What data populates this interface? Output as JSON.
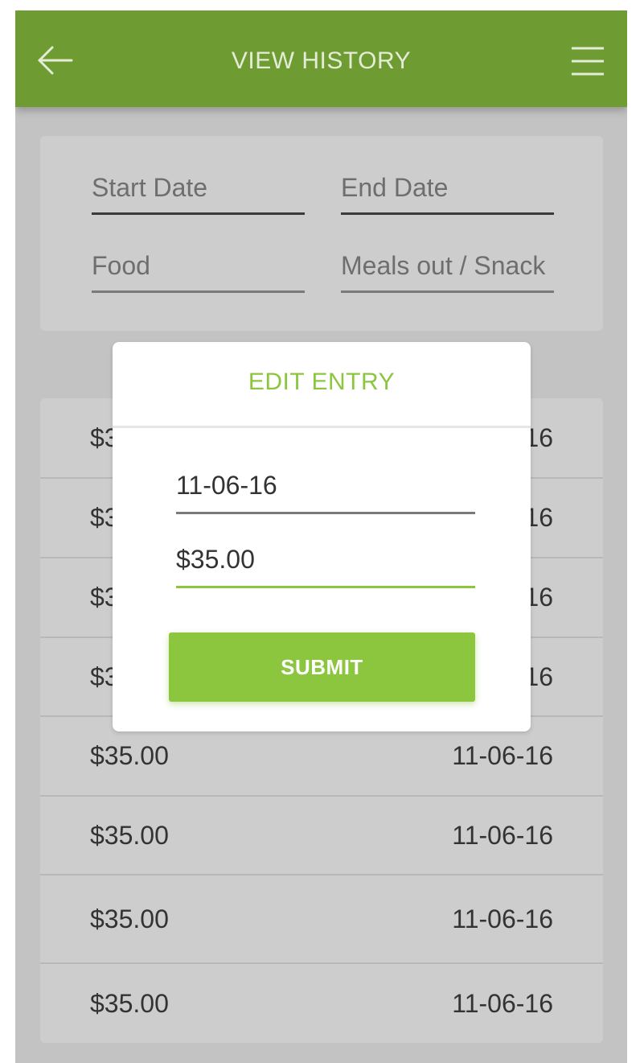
{
  "header": {
    "title": "VIEW HISTORY",
    "back_icon": "arrow-left-icon",
    "menu_icon": "hamburger-menu-icon",
    "background_color": "#6f9c32"
  },
  "filters": {
    "start_date_placeholder": "Start Date",
    "end_date_placeholder": "End Date",
    "food_placeholder": "Food",
    "meals_placeholder": "Meals out / Snack"
  },
  "entries": [
    {
      "amount": "$35.00",
      "date": "11-06-16"
    },
    {
      "amount": "$35.00",
      "date": "11-06-16"
    },
    {
      "amount": "$35.00",
      "date": "11-06-16"
    },
    {
      "amount": "$35.00",
      "date": "11-06-16"
    },
    {
      "amount": "$35.00",
      "date": "11-06-16"
    },
    {
      "amount": "$35.00",
      "date": "11-06-16"
    },
    {
      "amount": "$35.00",
      "date": "11-06-16"
    },
    {
      "amount": "$35.00",
      "date": "11-06-16"
    }
  ],
  "dialog": {
    "title": "EDIT ENTRY",
    "date_value": "11-06-16",
    "amount_value": "$35.00",
    "submit_label": "SUBMIT",
    "accent_color": "#8cc63f"
  }
}
